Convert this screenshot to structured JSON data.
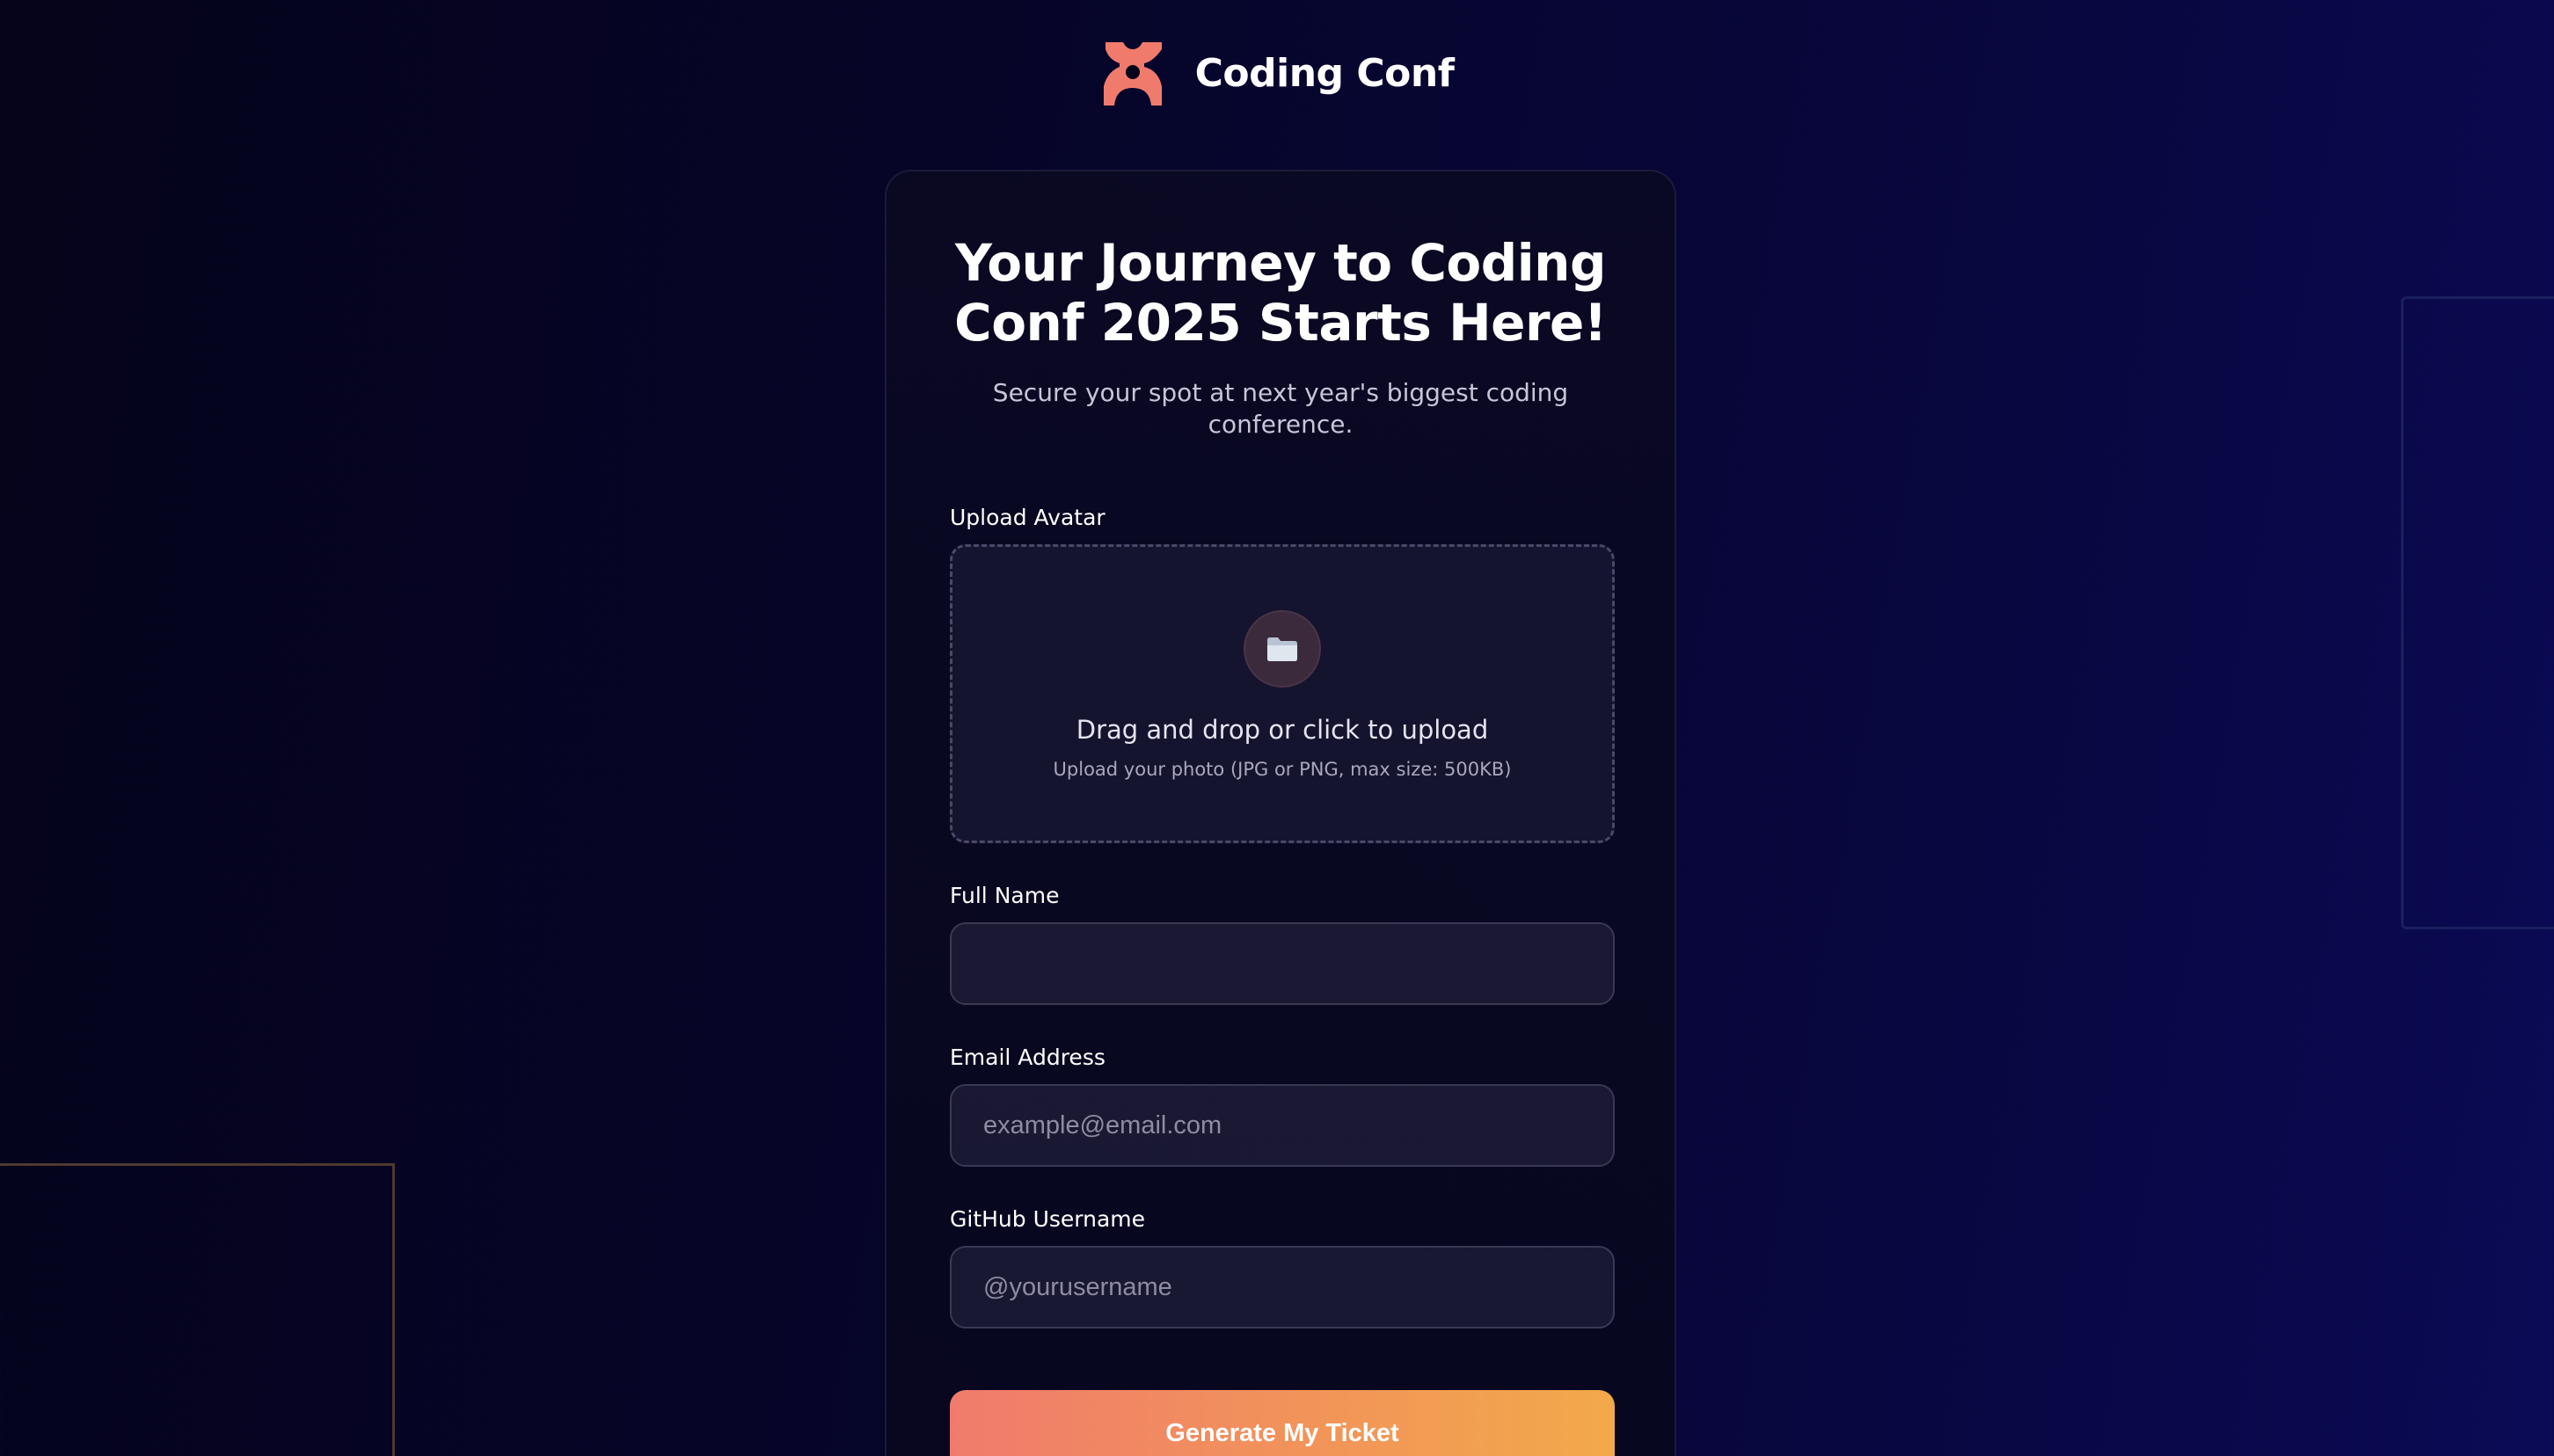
{
  "brand": {
    "name": "Coding Conf",
    "logo_icon": "coding-conf-logo-icon",
    "logo_color": "#f07b6c"
  },
  "hero": {
    "title": "Your Journey to Coding Conf 2025 Starts Here!",
    "subtitle": "Secure your spot at next year's biggest coding conference."
  },
  "form": {
    "avatar": {
      "label": "Upload Avatar",
      "icon": "folder-icon",
      "title": "Drag and drop or click to upload",
      "hint": "Upload your photo (JPG or PNG, max size: 500KB)"
    },
    "full_name": {
      "label": "Full Name",
      "value": "",
      "placeholder": ""
    },
    "email": {
      "label": "Email Address",
      "value": "",
      "placeholder": "example@email.com"
    },
    "github": {
      "label": "GitHub Username",
      "value": "",
      "placeholder": "@yourusername"
    },
    "submit_label": "Generate My Ticket"
  },
  "colors": {
    "background": "#07062e",
    "accent_start": "#f07b6c",
    "accent_end": "#f3a94a",
    "card_border": "#1c1b3a"
  }
}
